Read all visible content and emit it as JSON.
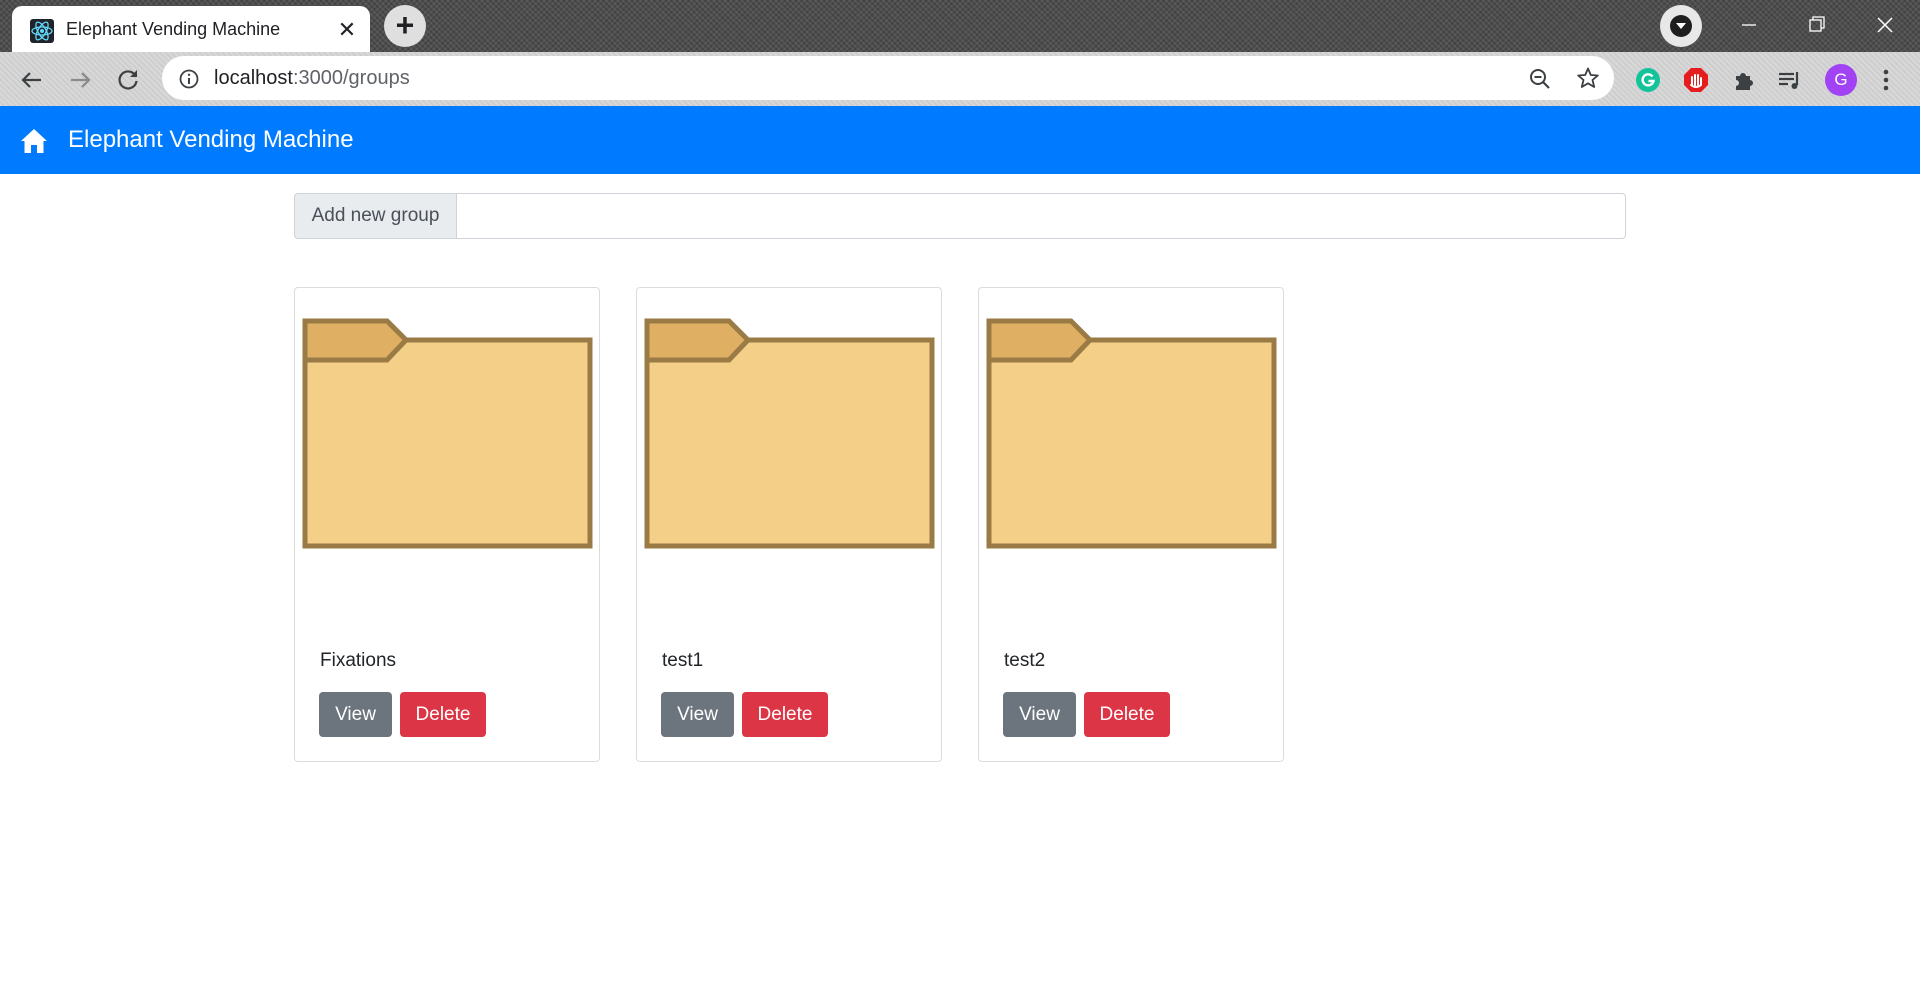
{
  "browser": {
    "tab_title": "Elephant Vending Machine",
    "tab_close_glyph": "✕",
    "new_tab_glyph": "+",
    "url_host": "localhost",
    "url_path": ":3000/groups",
    "avatar_letter": "G",
    "icons": [
      "react-favicon-icon",
      "back-arrow-icon",
      "forward-arrow-icon",
      "reload-icon",
      "info-icon",
      "zoom-out-icon",
      "star-icon",
      "grammarly-icon",
      "adblock-icon",
      "extensions-puzzle-icon",
      "media-control-icon",
      "more-vert-icon",
      "minimize-icon",
      "restore-icon",
      "close-icon"
    ]
  },
  "app": {
    "brand": "Elephant Vending Machine",
    "home_icon": "home-icon",
    "navbar_color": "#007bff"
  },
  "add_group": {
    "label": "Add new group",
    "value": "",
    "placeholder": ""
  },
  "groups": [
    {
      "name": "Fixations",
      "view_label": "View",
      "delete_label": "Delete"
    },
    {
      "name": "test1",
      "view_label": "View",
      "delete_label": "Delete"
    },
    {
      "name": "test2",
      "view_label": "View",
      "delete_label": "Delete"
    }
  ],
  "colors": {
    "view_button": "#6c757d",
    "delete_button": "#dc3545",
    "folder_fill": "#f3cf88",
    "folder_tab": "#dfb063",
    "folder_border": "#9a7b45"
  }
}
